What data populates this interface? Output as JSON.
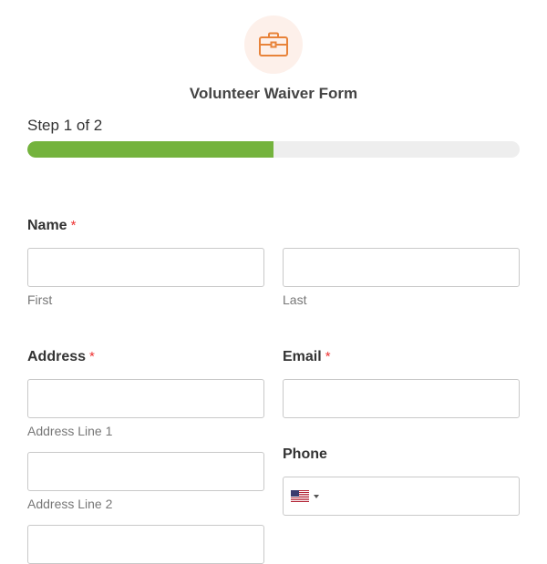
{
  "header": {
    "icon": "briefcase-icon",
    "title": "Volunteer Waiver Form"
  },
  "progress": {
    "step_text": "Step 1 of 2",
    "fraction": 0.5,
    "fill_color": "#74b33d",
    "track_color": "#eeeeee"
  },
  "fields": {
    "name": {
      "label": "Name",
      "required_mark": "*",
      "first": {
        "value": "",
        "sublabel": "First"
      },
      "last": {
        "value": "",
        "sublabel": "Last"
      }
    },
    "address": {
      "label": "Address",
      "required_mark": "*",
      "line1": {
        "value": "",
        "sublabel": "Address Line 1"
      },
      "line2": {
        "value": "",
        "sublabel": "Address Line 2"
      },
      "line3": {
        "value": ""
      }
    },
    "email": {
      "label": "Email",
      "required_mark": "*",
      "value": ""
    },
    "phone": {
      "label": "Phone",
      "country_icon": "us-flag-icon",
      "value": ""
    }
  },
  "colors": {
    "accent": "#e8833a",
    "required": "#ee3333"
  }
}
